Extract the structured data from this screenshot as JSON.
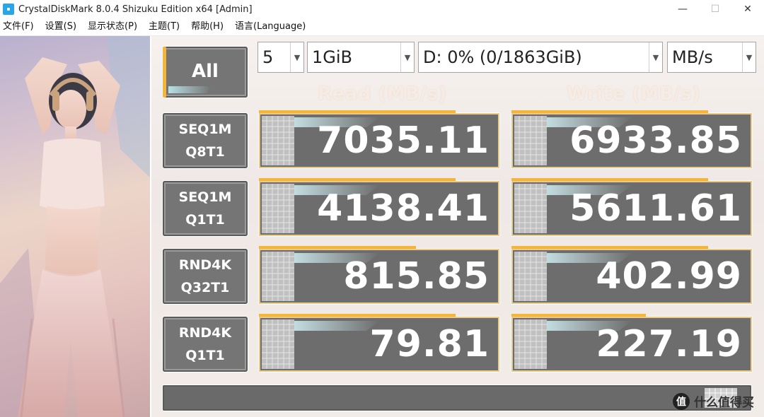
{
  "window": {
    "title": "CrystalDiskMark 8.0.4 Shizuku Edition x64 [Admin]",
    "minimize_glyph": "—",
    "maximize_glyph": "☐",
    "close_glyph": "✕"
  },
  "menu": [
    "文件(F)",
    "设置(S)",
    "显示状态(P)",
    "主题(T)",
    "帮助(H)",
    "语言(Language)"
  ],
  "controls": {
    "all_button": "All",
    "runs": "5",
    "size": "1GiB",
    "drive": "D: 0% (0/1863GiB)",
    "unit": "MB/s"
  },
  "headers": {
    "read": "Read (MB/s)",
    "write": "Write (MB/s)"
  },
  "tests": [
    {
      "line1": "SEQ1M",
      "line2": "Q8T1",
      "read": "7035.11",
      "write": "6933.85"
    },
    {
      "line1": "SEQ1M",
      "line2": "Q1T1",
      "read": "4138.41",
      "write": "5611.61"
    },
    {
      "line1": "RND4K",
      "line2": "Q32T1",
      "read": "815.85",
      "write": "402.99"
    },
    {
      "line1": "RND4K",
      "line2": "Q1T1",
      "read": "79.81",
      "write": "227.19"
    }
  ],
  "status_text": "",
  "watermark": {
    "glyph": "值",
    "text": "什么值得买"
  },
  "colors": {
    "accent": "#f4b538",
    "tile": "#757575",
    "bar": "#6d6d6d"
  }
}
